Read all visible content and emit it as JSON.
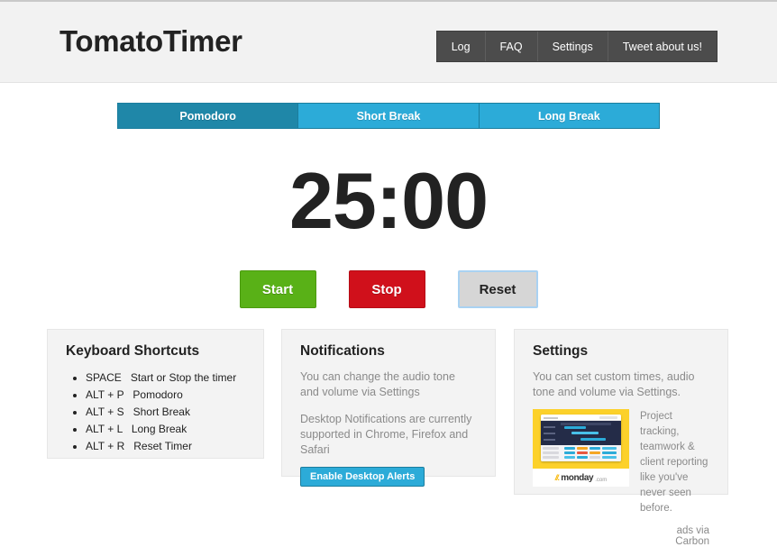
{
  "header": {
    "brand": "TomatoTimer",
    "nav": [
      {
        "label": "Log"
      },
      {
        "label": "FAQ"
      },
      {
        "label": "Settings"
      },
      {
        "label": "Tweet about us!"
      }
    ]
  },
  "tabs": [
    {
      "label": "Pomodoro",
      "active": true
    },
    {
      "label": "Short Break",
      "active": false
    },
    {
      "label": "Long Break",
      "active": false
    }
  ],
  "timer": {
    "display": "25:00",
    "minutes": 25,
    "seconds": 0
  },
  "controls": {
    "start": "Start",
    "stop": "Stop",
    "reset": "Reset"
  },
  "panels": {
    "keyboard": {
      "title": "Keyboard Shortcuts",
      "shortcuts": [
        {
          "key": "SPACE",
          "desc": "Start or Stop the timer"
        },
        {
          "key": "ALT + P",
          "desc": "Pomodoro"
        },
        {
          "key": "ALT + S",
          "desc": "Short Break"
        },
        {
          "key": "ALT + L",
          "desc": "Long Break"
        },
        {
          "key": "ALT + R",
          "desc": "Reset Timer"
        }
      ]
    },
    "notifications": {
      "title": "Notifications",
      "paragraph1": "You can change the audio tone and volume via Settings",
      "paragraph2": "Desktop Notifications are currently supported in Chrome, Firefox and Safari",
      "button": "Enable Desktop Alerts"
    },
    "settings": {
      "title": "Settings",
      "paragraph1": "You can set custom times, audio tone and volume via Settings.",
      "ad": {
        "text": "Project tracking, teamwork & client reporting like you've never seen before.",
        "logo_text": "monday",
        "logo_tld": ".com",
        "via": "ads via Carbon"
      }
    }
  },
  "colors": {
    "tab_active": "#1f87a8",
    "tab_inactive": "#2cabd8",
    "start": "#59b117",
    "stop": "#d0101b",
    "reset": "#d6d6d6",
    "nav_bg": "#4c4c4c",
    "panel_bg": "#f3f3f3",
    "ad_bg": "#fcd12a"
  }
}
